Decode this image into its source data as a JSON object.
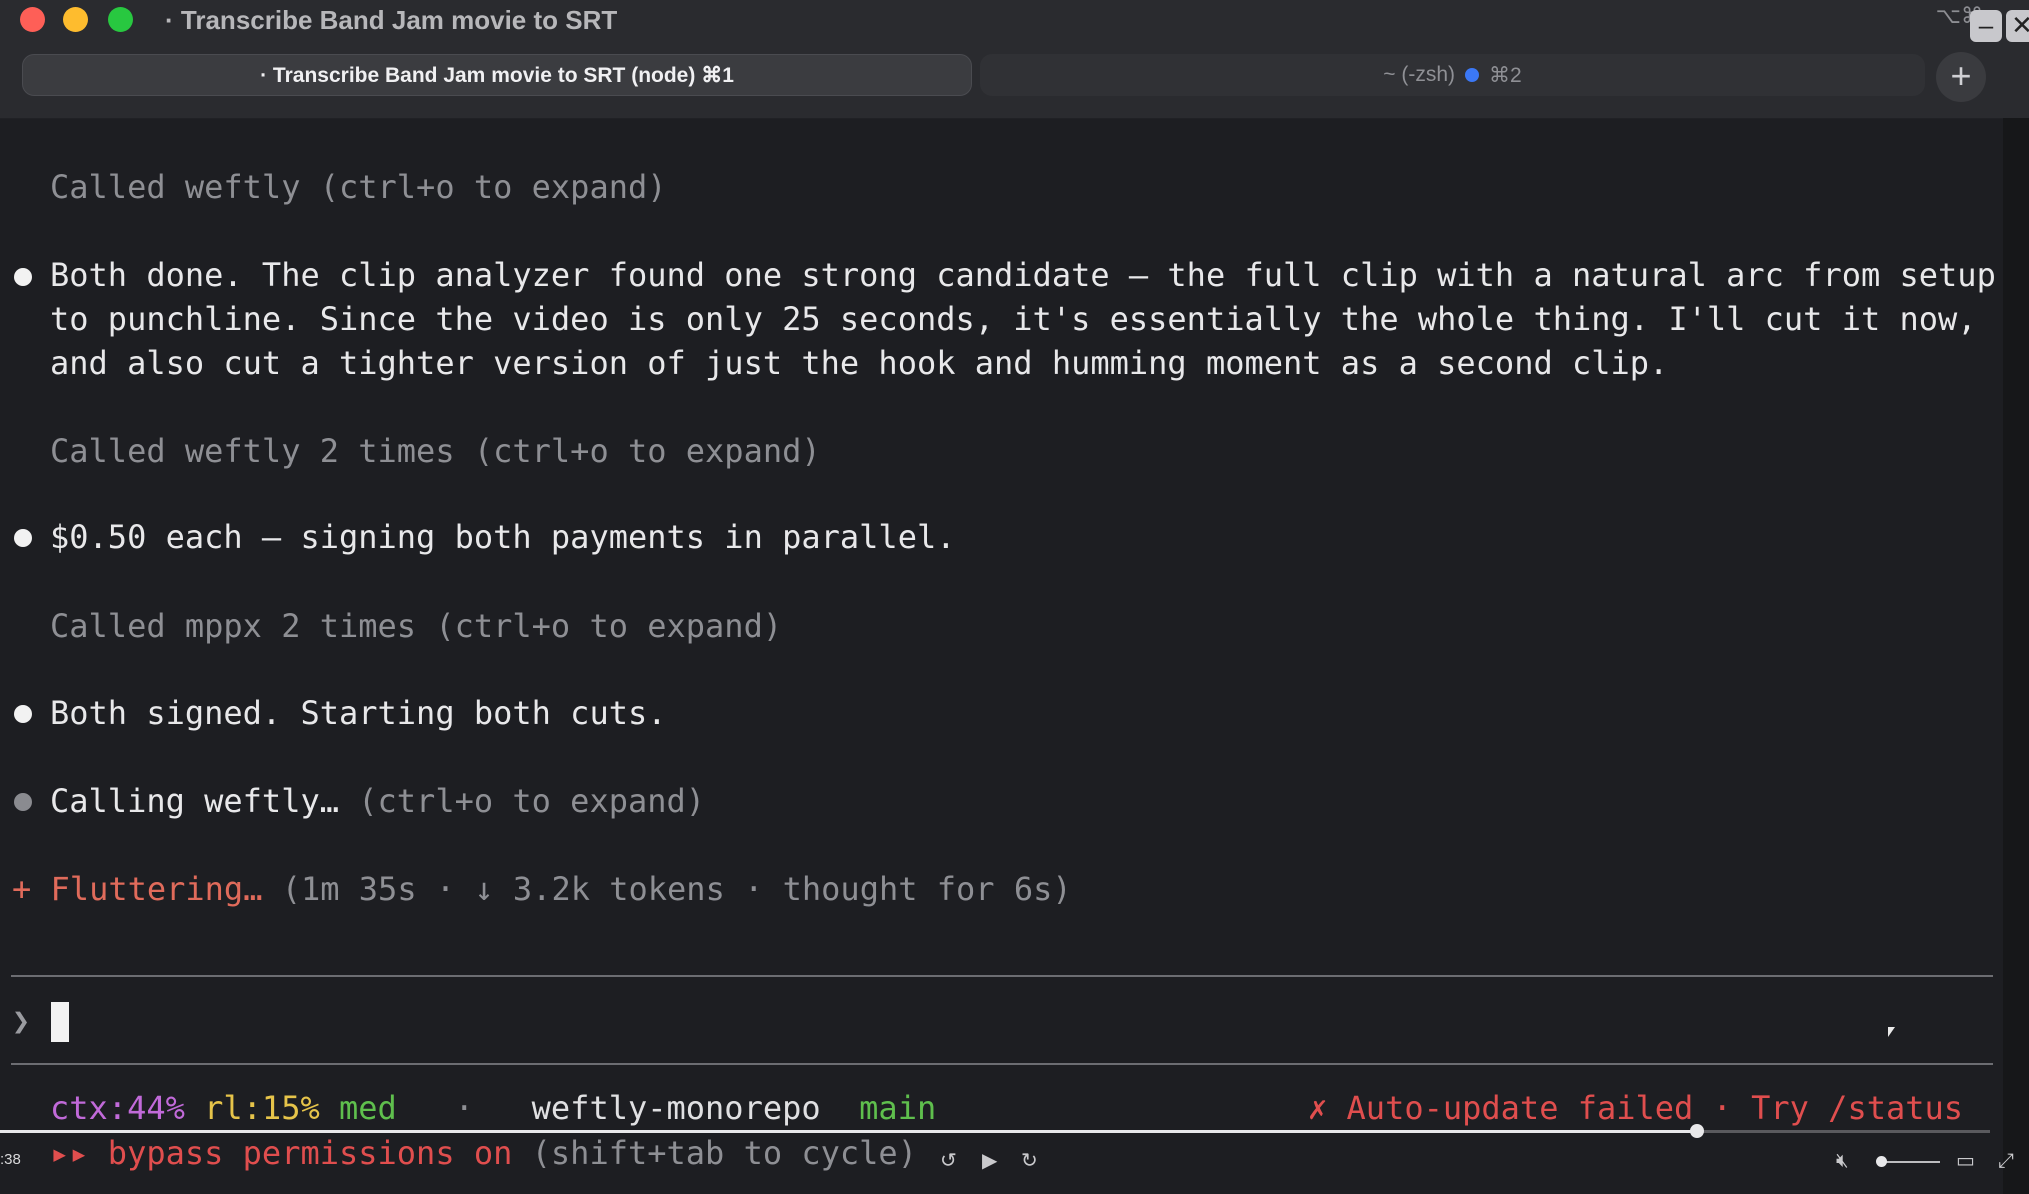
{
  "window": {
    "title_dot": "·",
    "title": "Transcribe Band Jam movie to SRT",
    "shortcut": "⌥⌘",
    "minimize_label": "–",
    "close_label": "✕"
  },
  "tabs": [
    {
      "label": "· Transcribe Band Jam movie to SRT (node) ⌘1",
      "active": true
    },
    {
      "label": "~ (-zsh)",
      "shortcut": "⌘2",
      "active": false,
      "indicator_color": "#3b78f6"
    }
  ],
  "new_tab_label": "+",
  "terminal": {
    "lines": [
      {
        "kind": "tool",
        "text": "Called weftly (ctrl+o to expand)"
      },
      {
        "kind": "message",
        "text": [
          "Both done. The clip analyzer found one strong candidate — the full clip with a natural arc from setup",
          "to punchline. Since the video is only 25 seconds, it's essentially the whole thing. I'll cut it now,",
          "and also cut a tighter version of just the hook and humming moment as a second clip."
        ]
      },
      {
        "kind": "tool",
        "text": "Called weftly 2 times (ctrl+o to expand)"
      },
      {
        "kind": "message",
        "text": [
          "$0.50 each — signing both payments in parallel."
        ]
      },
      {
        "kind": "tool",
        "text": "Called mppx 2 times (ctrl+o to expand)"
      },
      {
        "kind": "message",
        "text": [
          "Both signed. Starting both cuts."
        ]
      },
      {
        "kind": "calling",
        "main": "Calling weftly…",
        "hint": "(ctrl+o to expand)"
      },
      {
        "kind": "spinner",
        "icon": "+",
        "word": "Fluttering…",
        "stats": "(1m 35s · ↓ 3.2k tokens · thought for 6s)"
      }
    ],
    "prompt_symbol": "❯",
    "prompt_value": ""
  },
  "status_bar": {
    "ctx": "ctx:44%",
    "rl": "rl:15%",
    "effort": "med",
    "separator": "·",
    "repo": "weftly-monorepo",
    "branch": "main",
    "update_error": "✗ Auto-update failed · Try /status",
    "mode_icon": "▸▸",
    "mode_text": "bypass permissions on",
    "mode_hint": "(shift+tab to cycle)"
  },
  "player": {
    "time": ":38",
    "progress": 0.853,
    "volume_muted": true,
    "volume_level": 0.05
  },
  "colors": {
    "background": "#1d1e22",
    "accent_orange": "#e06b5b",
    "error_red": "#e04e4e",
    "ctx_magenta": "#c16ad9",
    "rl_yellow": "#e6c44a",
    "branch_green": "#5fbf4d"
  },
  "icons": {
    "rewind": "rewind-10-icon",
    "play": "play-icon",
    "forward": "forward-10-icon",
    "mute": "volume-muted-icon",
    "captions": "captions-icon",
    "fullscreen": "fullscreen-icon"
  }
}
